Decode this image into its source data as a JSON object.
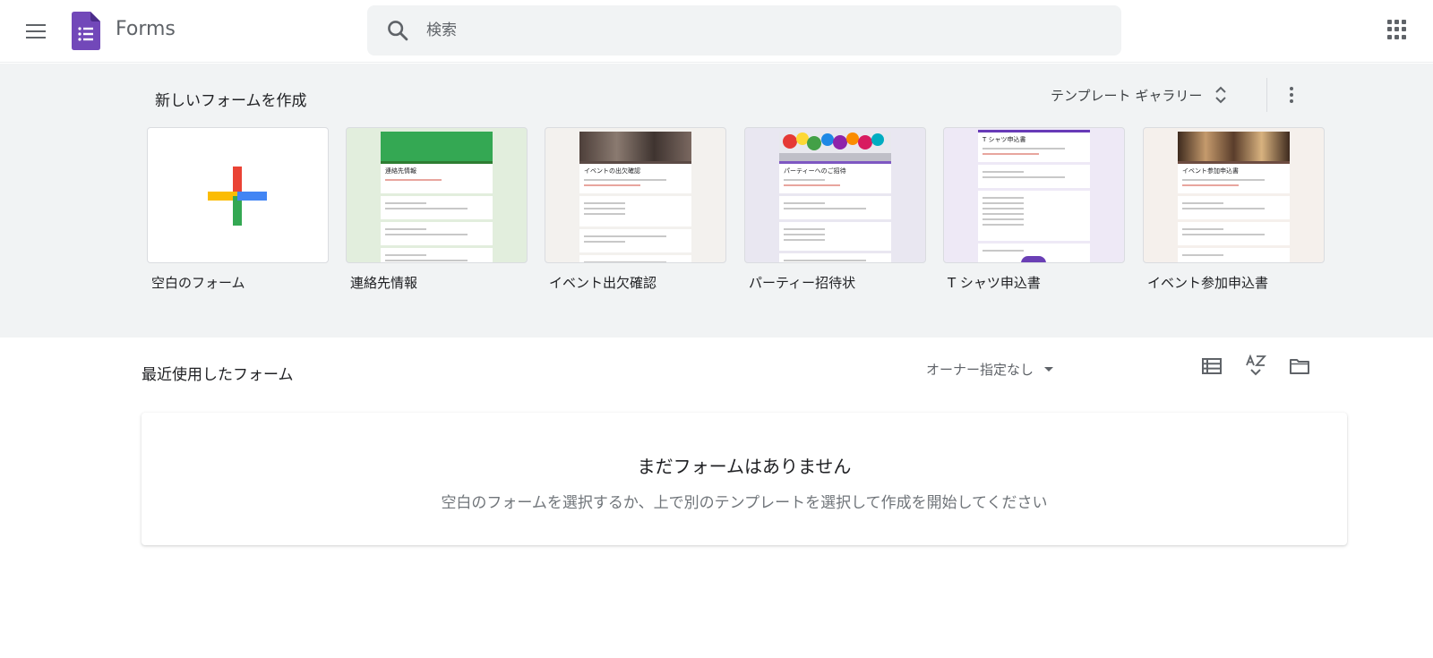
{
  "header": {
    "app_name": "Forms",
    "search_placeholder": "検索"
  },
  "templates": {
    "title": "新しいフォームを作成",
    "gallery_label": "テンプレート ギャラリー",
    "items": [
      {
        "label": "空白のフォーム"
      },
      {
        "label": "連絡先情報",
        "preview_title": "連絡先情報",
        "banner_color": "#34a853",
        "background": "#e2eedd"
      },
      {
        "label": "イベント出欠確認",
        "preview_title": "イベントの出欠確認",
        "banner_color": "#5b4a45",
        "background": "#f3f1ee"
      },
      {
        "label": "パーティー招待状",
        "preview_title": "パーティーへのご招待",
        "banner_color": "#7e57c2",
        "background": "#e9e7f1"
      },
      {
        "label": "T シャツ申込書",
        "preview_title": "T シャツ申込書",
        "banner_color": "#673ab7",
        "background": "#eee9f6"
      },
      {
        "label": "イベント参加申込書",
        "preview_title": "イベント参加申込書",
        "banner_color": "#6d4c41",
        "background": "#f5f0ec"
      }
    ]
  },
  "recent": {
    "title": "最近使用したフォーム",
    "owner_filter": "オーナー指定なし",
    "empty_title": "まだフォームはありません",
    "empty_subtitle": "空白のフォームを選択するか、上で別のテンプレートを選択して作成を開始してください"
  },
  "colors": {
    "forms_purple": "#673ab7",
    "google_red": "#ea4335",
    "google_blue": "#4285f4",
    "google_yellow": "#fbbc04",
    "google_green": "#34a853"
  }
}
